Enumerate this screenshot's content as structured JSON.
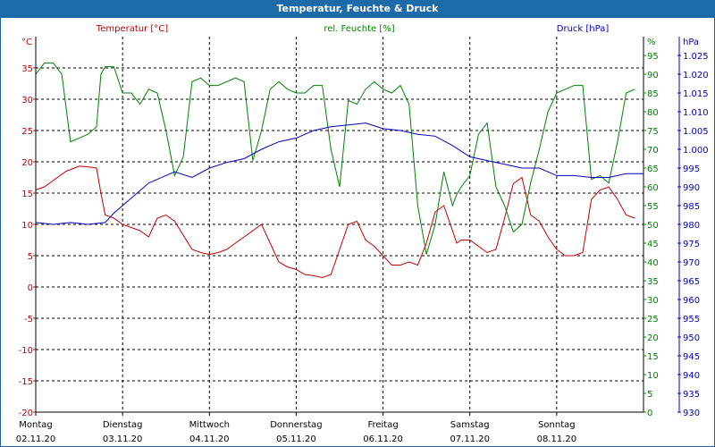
{
  "title": "Temperatur, Feuchte & Druck",
  "colors": {
    "temperature": "#c00000",
    "humidity": "#008000",
    "pressure": "#0000c0",
    "grid": "#000000"
  },
  "chart_data": {
    "type": "line",
    "title": "Temperatur, Feuchte & Druck",
    "grid": true,
    "x_ticks": [
      {
        "day": "Montag",
        "date": "02.11.20"
      },
      {
        "day": "Dienstag",
        "date": "03.11.20"
      },
      {
        "day": "Mittwoch",
        "date": "04.11.20"
      },
      {
        "day": "Donnerstag",
        "date": "05.11.20"
      },
      {
        "day": "Freitag",
        "date": "06.11.20"
      },
      {
        "day": "Samstag",
        "date": "07.11.20"
      },
      {
        "day": "Sonntag",
        "date": "08.11.20"
      }
    ],
    "x_range_days": [
      0,
      7
    ],
    "axes": {
      "temperature": {
        "label": "Temperatur [°C]",
        "unit": "°C",
        "range": [
          -20,
          40
        ],
        "ticks": [
          "35",
          "30",
          "25",
          "20",
          "15",
          "10",
          "5",
          "0",
          "-5",
          "-10",
          "-15",
          "-20"
        ],
        "tick_values": [
          35,
          30,
          25,
          20,
          15,
          10,
          5,
          0,
          -5,
          -10,
          -15,
          -20
        ]
      },
      "humidity": {
        "label": "rel. Feuchte [%]",
        "unit": "%",
        "range": [
          0,
          100
        ],
        "ticks": [
          "95",
          "90",
          "85",
          "80",
          "75",
          "70",
          "65",
          "60",
          "55",
          "50",
          "45",
          "40",
          "35",
          "30",
          "25",
          "20",
          "15",
          "10",
          "5",
          "0"
        ],
        "tick_values": [
          95,
          90,
          85,
          80,
          75,
          70,
          65,
          60,
          55,
          50,
          45,
          40,
          35,
          30,
          25,
          20,
          15,
          10,
          5,
          0
        ]
      },
      "pressure": {
        "label": "Druck [hPa]",
        "unit": "hPa",
        "range": [
          930,
          1030
        ],
        "ticks": [
          "1.025",
          "1.020",
          "1.015",
          "1.010",
          "1.005",
          "1.000",
          "995",
          "990",
          "985",
          "980",
          "975",
          "970",
          "965",
          "960",
          "955",
          "950",
          "945",
          "940",
          "935",
          "930"
        ],
        "tick_values": [
          1025,
          1020,
          1015,
          1010,
          1005,
          1000,
          995,
          990,
          985,
          980,
          975,
          970,
          965,
          960,
          955,
          950,
          945,
          940,
          935,
          930
        ]
      }
    },
    "series": [
      {
        "name": "Temperatur [°C]",
        "axis": "temperature",
        "x": [
          0,
          0.1,
          0.2,
          0.35,
          0.5,
          0.6,
          0.7,
          0.75,
          0.8,
          0.9,
          1.0,
          1.2,
          1.3,
          1.4,
          1.5,
          1.6,
          1.8,
          1.9,
          2.0,
          2.1,
          2.2,
          2.3,
          2.5,
          2.6,
          2.7,
          2.8,
          2.9,
          3.0,
          3.1,
          3.2,
          3.3,
          3.4,
          3.5,
          3.6,
          3.7,
          3.8,
          3.9,
          4.0,
          4.1,
          4.2,
          4.3,
          4.4,
          4.5,
          4.6,
          4.7,
          4.8,
          4.85,
          4.9,
          5.0,
          5.1,
          5.2,
          5.3,
          5.4,
          5.5,
          5.6,
          5.7,
          5.8,
          5.9,
          6.0,
          6.1,
          6.2,
          6.3,
          6.4,
          6.5,
          6.6,
          6.7,
          6.8,
          6.9
        ],
        "y": [
          15.5,
          16,
          17,
          18.5,
          19.3,
          19.2,
          19,
          15,
          11.5,
          11,
          10,
          9,
          8,
          11,
          11.5,
          10.5,
          6,
          5.5,
          5.2,
          5.5,
          6,
          7,
          9,
          10,
          7,
          4,
          3.2,
          2.8,
          2,
          1.8,
          1.5,
          2,
          6,
          10,
          10.5,
          7.5,
          6.5,
          5,
          3.5,
          3.5,
          4,
          3.5,
          7,
          12,
          13,
          9,
          7,
          7.5,
          7.5,
          6.5,
          5.5,
          6,
          11,
          16.5,
          17.5,
          11.5,
          10.5,
          8,
          6,
          5,
          5,
          5.5,
          14,
          15.5,
          16,
          14,
          11.5,
          11
        ]
      },
      {
        "name": "rel. Feuchte [%]",
        "axis": "humidity",
        "x": [
          0,
          0.1,
          0.2,
          0.3,
          0.4,
          0.5,
          0.6,
          0.7,
          0.75,
          0.8,
          0.9,
          1.0,
          1.1,
          1.2,
          1.3,
          1.4,
          1.5,
          1.6,
          1.7,
          1.8,
          1.9,
          2.0,
          2.1,
          2.3,
          2.4,
          2.5,
          2.6,
          2.7,
          2.8,
          2.9,
          3.0,
          3.1,
          3.2,
          3.3,
          3.4,
          3.5,
          3.6,
          3.7,
          3.8,
          3.9,
          4.0,
          4.1,
          4.2,
          4.3,
          4.4,
          4.5,
          4.6,
          4.7,
          4.8,
          4.85,
          4.9,
          5.0,
          5.1,
          5.2,
          5.3,
          5.4,
          5.5,
          5.6,
          5.7,
          5.8,
          5.9,
          6.0,
          6.1,
          6.2,
          6.3,
          6.4,
          6.5,
          6.6,
          6.7,
          6.8,
          6.9
        ],
        "y": [
          90,
          93,
          93,
          90,
          72,
          73,
          74,
          76,
          90,
          92,
          92,
          85,
          85,
          82,
          86,
          85,
          75,
          63,
          68,
          88,
          89,
          87,
          87,
          89,
          88,
          67,
          75,
          86,
          88,
          86,
          85,
          85,
          87,
          87,
          70,
          60,
          83,
          82,
          86,
          88,
          86,
          85,
          87,
          82,
          55,
          42,
          50,
          64,
          55,
          58,
          60,
          63,
          74,
          77,
          60,
          55,
          48,
          50,
          61,
          70,
          80,
          85,
          86,
          87,
          87,
          62,
          63,
          61,
          72,
          85,
          86
        ]
      },
      {
        "name": "Druck [hPa]",
        "axis": "pressure",
        "x": [
          0,
          0.2,
          0.4,
          0.6,
          0.8,
          0.9,
          1.0,
          1.1,
          1.2,
          1.3,
          1.4,
          1.6,
          1.8,
          2.0,
          2.2,
          2.4,
          2.6,
          2.8,
          3.0,
          3.2,
          3.4,
          3.6,
          3.8,
          4.0,
          4.2,
          4.4,
          4.6,
          4.8,
          5.0,
          5.2,
          5.4,
          5.6,
          5.8,
          6.0,
          6.2,
          6.4,
          6.6,
          6.8,
          7.0
        ],
        "y": [
          980.5,
          980,
          980.5,
          980,
          980.5,
          983,
          985,
          987,
          989,
          991,
          992,
          994,
          992.5,
          995,
          996.5,
          997.5,
          1000,
          1002,
          1003,
          1005,
          1006,
          1006.5,
          1007,
          1005.5,
          1005,
          1004,
          1003.5,
          1001,
          998,
          997,
          996,
          995,
          995,
          993,
          993,
          992.5,
          992.5,
          993.5,
          993.5
        ]
      }
    ]
  }
}
